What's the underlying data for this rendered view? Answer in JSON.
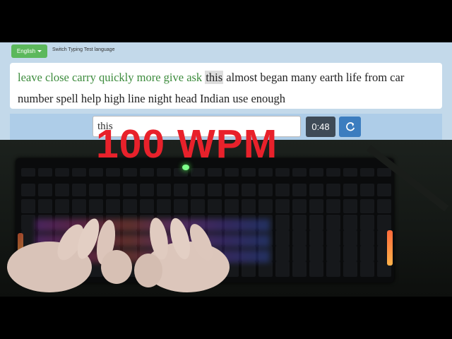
{
  "language": {
    "button_label": "English",
    "switch_label": "Switch Typing Test language"
  },
  "words": [
    {
      "text": "leave",
      "state": "correct"
    },
    {
      "text": "close",
      "state": "correct"
    },
    {
      "text": "carry",
      "state": "correct"
    },
    {
      "text": "quickly",
      "state": "correct"
    },
    {
      "text": "more",
      "state": "correct"
    },
    {
      "text": "give",
      "state": "correct"
    },
    {
      "text": "ask",
      "state": "correct"
    },
    {
      "text": "this",
      "state": "current"
    },
    {
      "text": "almost",
      "state": "pending"
    },
    {
      "text": "began",
      "state": "pending"
    },
    {
      "text": "many",
      "state": "pending"
    },
    {
      "text": "earth",
      "state": "pending"
    },
    {
      "text": "life",
      "state": "pending"
    },
    {
      "text": "from",
      "state": "pending"
    },
    {
      "text": "car",
      "state": "pending"
    },
    {
      "text": "number",
      "state": "pending"
    },
    {
      "text": "spell",
      "state": "pending"
    },
    {
      "text": "help",
      "state": "pending"
    },
    {
      "text": "high",
      "state": "pending"
    },
    {
      "text": "line",
      "state": "pending"
    },
    {
      "text": "night",
      "state": "pending"
    },
    {
      "text": "head",
      "state": "pending"
    },
    {
      "text": "Indian",
      "state": "pending"
    },
    {
      "text": "use",
      "state": "pending"
    },
    {
      "text": "enough",
      "state": "pending"
    }
  ],
  "input": {
    "value": "this"
  },
  "timer": {
    "value": "0:48"
  },
  "reset": {
    "icon": "refresh-icon"
  },
  "overlay": {
    "wpm_text": "100 WPM"
  },
  "colors": {
    "correct": "#3c8b3c",
    "wpm": "#e8212b",
    "button_green": "#5cb85c",
    "button_blue": "#3c7dbf"
  }
}
